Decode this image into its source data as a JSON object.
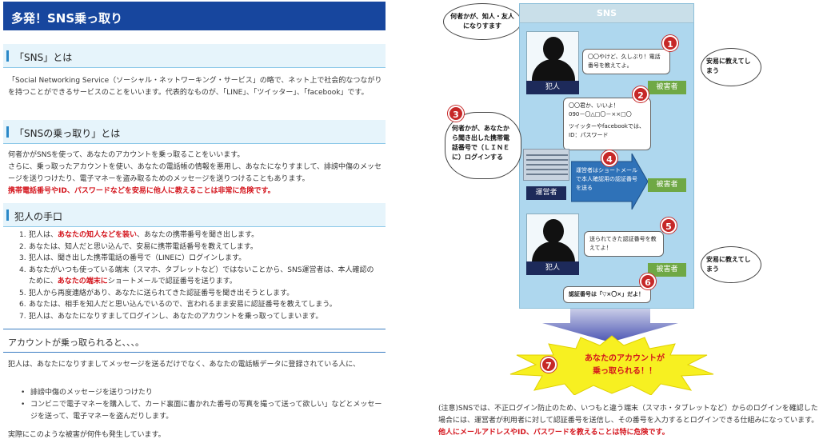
{
  "left": {
    "page_title": "多発！SNS乗っ取り",
    "section1": {
      "heading": "「SNS」とは",
      "text": "「Social Networking Service（ソーシャル・ネットワーキング・サービス」の略で、ネット上で社会的なつながりを持つことができるサービスのことをいいます。代表的なものが、「LINE」、「ツイッター」、「facebook」です。"
    },
    "section2": {
      "heading": "「SNSの乗っ取り」とは",
      "text1": "何者かがSNSを使って、あなたのアカウントを乗っ取ることをいいます。",
      "text2": "さらに、乗っ取ったアカウントを使い、あなたの電話帳の情報を悪用し、あなたになりすまして、誹謗中傷のメッセージを送りつけたり、電子マネーを盗み取るためのメッセージを送りつけることもあります。",
      "warning": "携帯電話番号やID、パスワードなどを安易に他人に教えることは非常に危険です。"
    },
    "section3": {
      "heading": "犯人の手口",
      "steps": [
        {
          "num": "1.",
          "pre": "犯人は、",
          "hl": "あなたの知人などを装い",
          "post": "、あなたの携帯番号を聞き出します。"
        },
        {
          "num": "2.",
          "pre": "あなたは、知人だと思い込んで、安易に携帯電話番号を教えてします。",
          "hl": "",
          "post": ""
        },
        {
          "num": "3.",
          "pre": "犯人は、聞き出した携帯電話の番号で（LINEに）ログインします。",
          "hl": "",
          "post": ""
        },
        {
          "num": "4.",
          "pre": "あなたがいつも使っている端末（スマホ、タブレットなど）ではないことから、SNS運営者は、本人確認のために、",
          "hl": "あなたの端末に",
          "post": "ショートメールで認証番号を送ります。"
        },
        {
          "num": "5.",
          "pre": "犯人から再度連絡があり、あなたに送られてきた認証番号を聞き出そうとします。",
          "hl": "",
          "post": ""
        },
        {
          "num": "6.",
          "pre": "あなたは、相手を知人だと思い込んでいるので、言われるまま安易に認証番号を教えてしまう。",
          "hl": "",
          "post": ""
        },
        {
          "num": "7.",
          "pre": "犯人は、あなたになりすましてログインし、あなたのアカウントを乗っ取ってしまいます。",
          "hl": "",
          "post": ""
        }
      ]
    },
    "section4": {
      "heading": "アカウントが乗っ取られると、、、。",
      "text": "犯人は、あなたになりすましてメッセージを送るだけでなく、あなたの電話帳データに登録されている人に、",
      "bullets": [
        "誹謗中傷のメッセージを送りつけたり",
        "コンビニで電子マネーを購入して、カード裏面に書かれた番号の写真を撮って送って欲しい」などとメッセージを送って、電子マネーを盗んだりします。"
      ],
      "footer": "実際にこのような被害が何件も発生しています。"
    }
  },
  "diagram": {
    "sns_label": "SNS",
    "cloud_top_left": "何者かが、知人・友人になりすます",
    "cloud_right_1": "安易に教えてしまう",
    "cloud_right_2": "安易に教えてしまう",
    "cloud_left_3": "何者かが、あなたから聞き出した携帯電話番号で（ＬＩＮＥに）ログインする",
    "criminal_label": "犯人",
    "victim_label": "被害者",
    "operator_label": "運営者",
    "bubble1": "〇〇やけど、久しぶり！電話番号を教えてよ。",
    "bubble2_line1": "〇〇君か、いいよ！",
    "bubble2_line2": "090－〇△□〇－××□〇",
    "bubble2_line3": "ツイッターやfacebookでは、ID：パスワード",
    "arrow_text": "運営者はショートメールで本人確認用の認証番号を送る",
    "bubble5": "送られてきた認証番号を教えてよ！",
    "bubble6": "認証番号は「▽×〇×」だよ！",
    "nums": [
      "1",
      "2",
      "3",
      "4",
      "5",
      "6",
      "7"
    ],
    "burst_line1": "あなたのアカウントが",
    "burst_line2": "乗っ取られる！！",
    "note_prefix": "(注意)SNSでは、不正ログイン防止のため、いつもと違う端末（スマホ・タブレットなど）からのログインを確認した場合には、運営者が利用者に対して認証番号を送信し、その番号を入力するとログインできる仕組みになっています。",
    "note_warning": "他人にメールアドレスやID、パスワードを教えることは特に危険です。"
  },
  "colors": {
    "title_bg": "#17469e",
    "section_bg": "#e6f4fb",
    "danger": "#d4141c",
    "phone_bg": "#aed7ee",
    "victim_green": "#6fa845",
    "burst_yellow": "#f7f021"
  }
}
